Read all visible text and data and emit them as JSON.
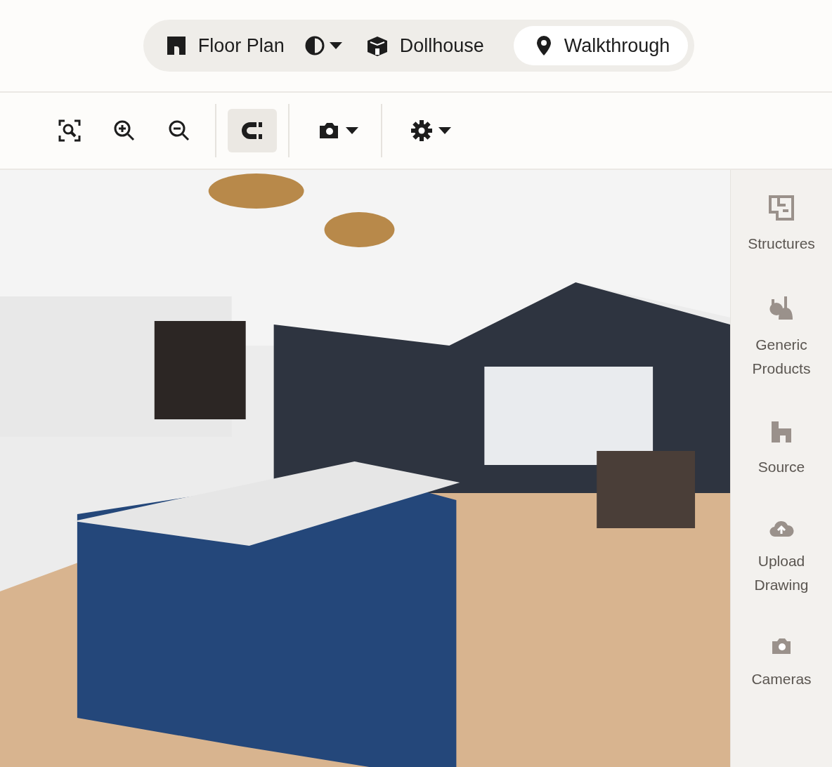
{
  "view_switcher": [
    {
      "kind": "mode",
      "label": "Floor Plan",
      "selected": false
    },
    {
      "kind": "menu",
      "selected": false
    },
    {
      "kind": "mode",
      "label": "Dollhouse",
      "selected": false
    },
    {
      "kind": "mode",
      "label": "Walkthrough",
      "selected": true
    }
  ],
  "toolbar": [
    [
      {
        "selected": false,
        "dropdown": false
      },
      {
        "selected": false,
        "dropdown": false
      },
      {
        "selected": false,
        "dropdown": false
      }
    ],
    [
      {
        "selected": true,
        "dropdown": false
      }
    ],
    [
      {
        "selected": false,
        "dropdown": true
      }
    ],
    [
      {
        "selected": false,
        "dropdown": true
      }
    ]
  ],
  "sidebar": {
    "items": [
      {
        "label": "Structures"
      },
      {
        "label": "Generic Products"
      },
      {
        "label": "Source"
      },
      {
        "label": "Upload Drawing"
      },
      {
        "label": "Cameras"
      }
    ]
  }
}
